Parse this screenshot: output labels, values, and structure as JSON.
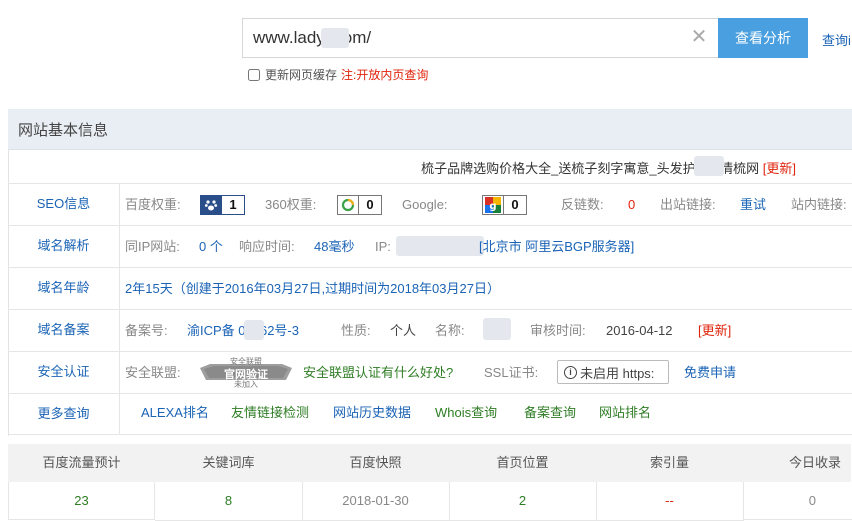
{
  "search": {
    "url_value": "www.lady .com/",
    "query_button": "查看分析",
    "query_record_link": "查询i",
    "refresh_label": "更新网页缓存",
    "note_label": "注:",
    "note_link": "开放内页查询"
  },
  "panel": {
    "title": "网站基本信息",
    "site_title": "梳子品牌选购价格大全_送梳子刻字寓意_头发护理 - 情梳网",
    "update_link": "[更新]"
  },
  "seo": {
    "label": "SEO信息",
    "baidu_label": "百度权重:",
    "baidu_value": "1",
    "so360_label": "360权重:",
    "so360_value": "0",
    "google_label": "Google:",
    "google_value": "0",
    "backlinks_label": "反链数:",
    "backlinks_value": "0",
    "outlinks_label": "出站链接:",
    "outlinks_value": "重试",
    "inlinks_label": "站内链接:"
  },
  "dns": {
    "label": "域名解析",
    "sameip_label": "同IP网站:",
    "sameip_value": "0 个",
    "response_label": "响应时间:",
    "response_value": "48毫秒",
    "ip_label": "IP:",
    "ip_location": "[北京市 阿里云BGP服务器]"
  },
  "age": {
    "label": "域名年龄",
    "value": "2年15天（创建于2016年03月27日,过期时间为2018年03月27日）"
  },
  "icp": {
    "label": "域名备案",
    "number_label": "备案号:",
    "number_value": "渝ICP备 03862号-3",
    "nature_label": "性质:",
    "nature_value": "个人",
    "name_label": "名称:",
    "audit_label": "审核时间:",
    "audit_value": "2016-04-12",
    "update_link": "[更新]"
  },
  "security": {
    "label": "安全认证",
    "alliance_label": "安全联盟:",
    "badge_top": "安全联盟",
    "badge_main": "官网验证",
    "badge_sub": "未加入",
    "alliance_link": "安全联盟认证有什么好处?",
    "ssl_label": "SSL证书:",
    "ssl_value": "未启用 https:",
    "ssl_apply": "免费申请"
  },
  "more": {
    "label": "更多查询",
    "links": [
      "ALEXA排名",
      "友情链接检测",
      "网站历史数据",
      "Whois查询",
      "备案查询",
      "网站排名"
    ]
  },
  "stats": {
    "headers": [
      "百度流量预计",
      "关键词库",
      "百度快照",
      "首页位置",
      "索引量",
      "今日收录"
    ],
    "values": [
      "23",
      "8",
      "2018-01-30",
      "2",
      "--",
      "0"
    ]
  },
  "colors": {
    "accent": "#4a9fe0",
    "link_blue": "#1a63b5",
    "link_green": "#2e7d24",
    "alert_red": "#e0230b",
    "header_bg": "#e9eef4"
  }
}
